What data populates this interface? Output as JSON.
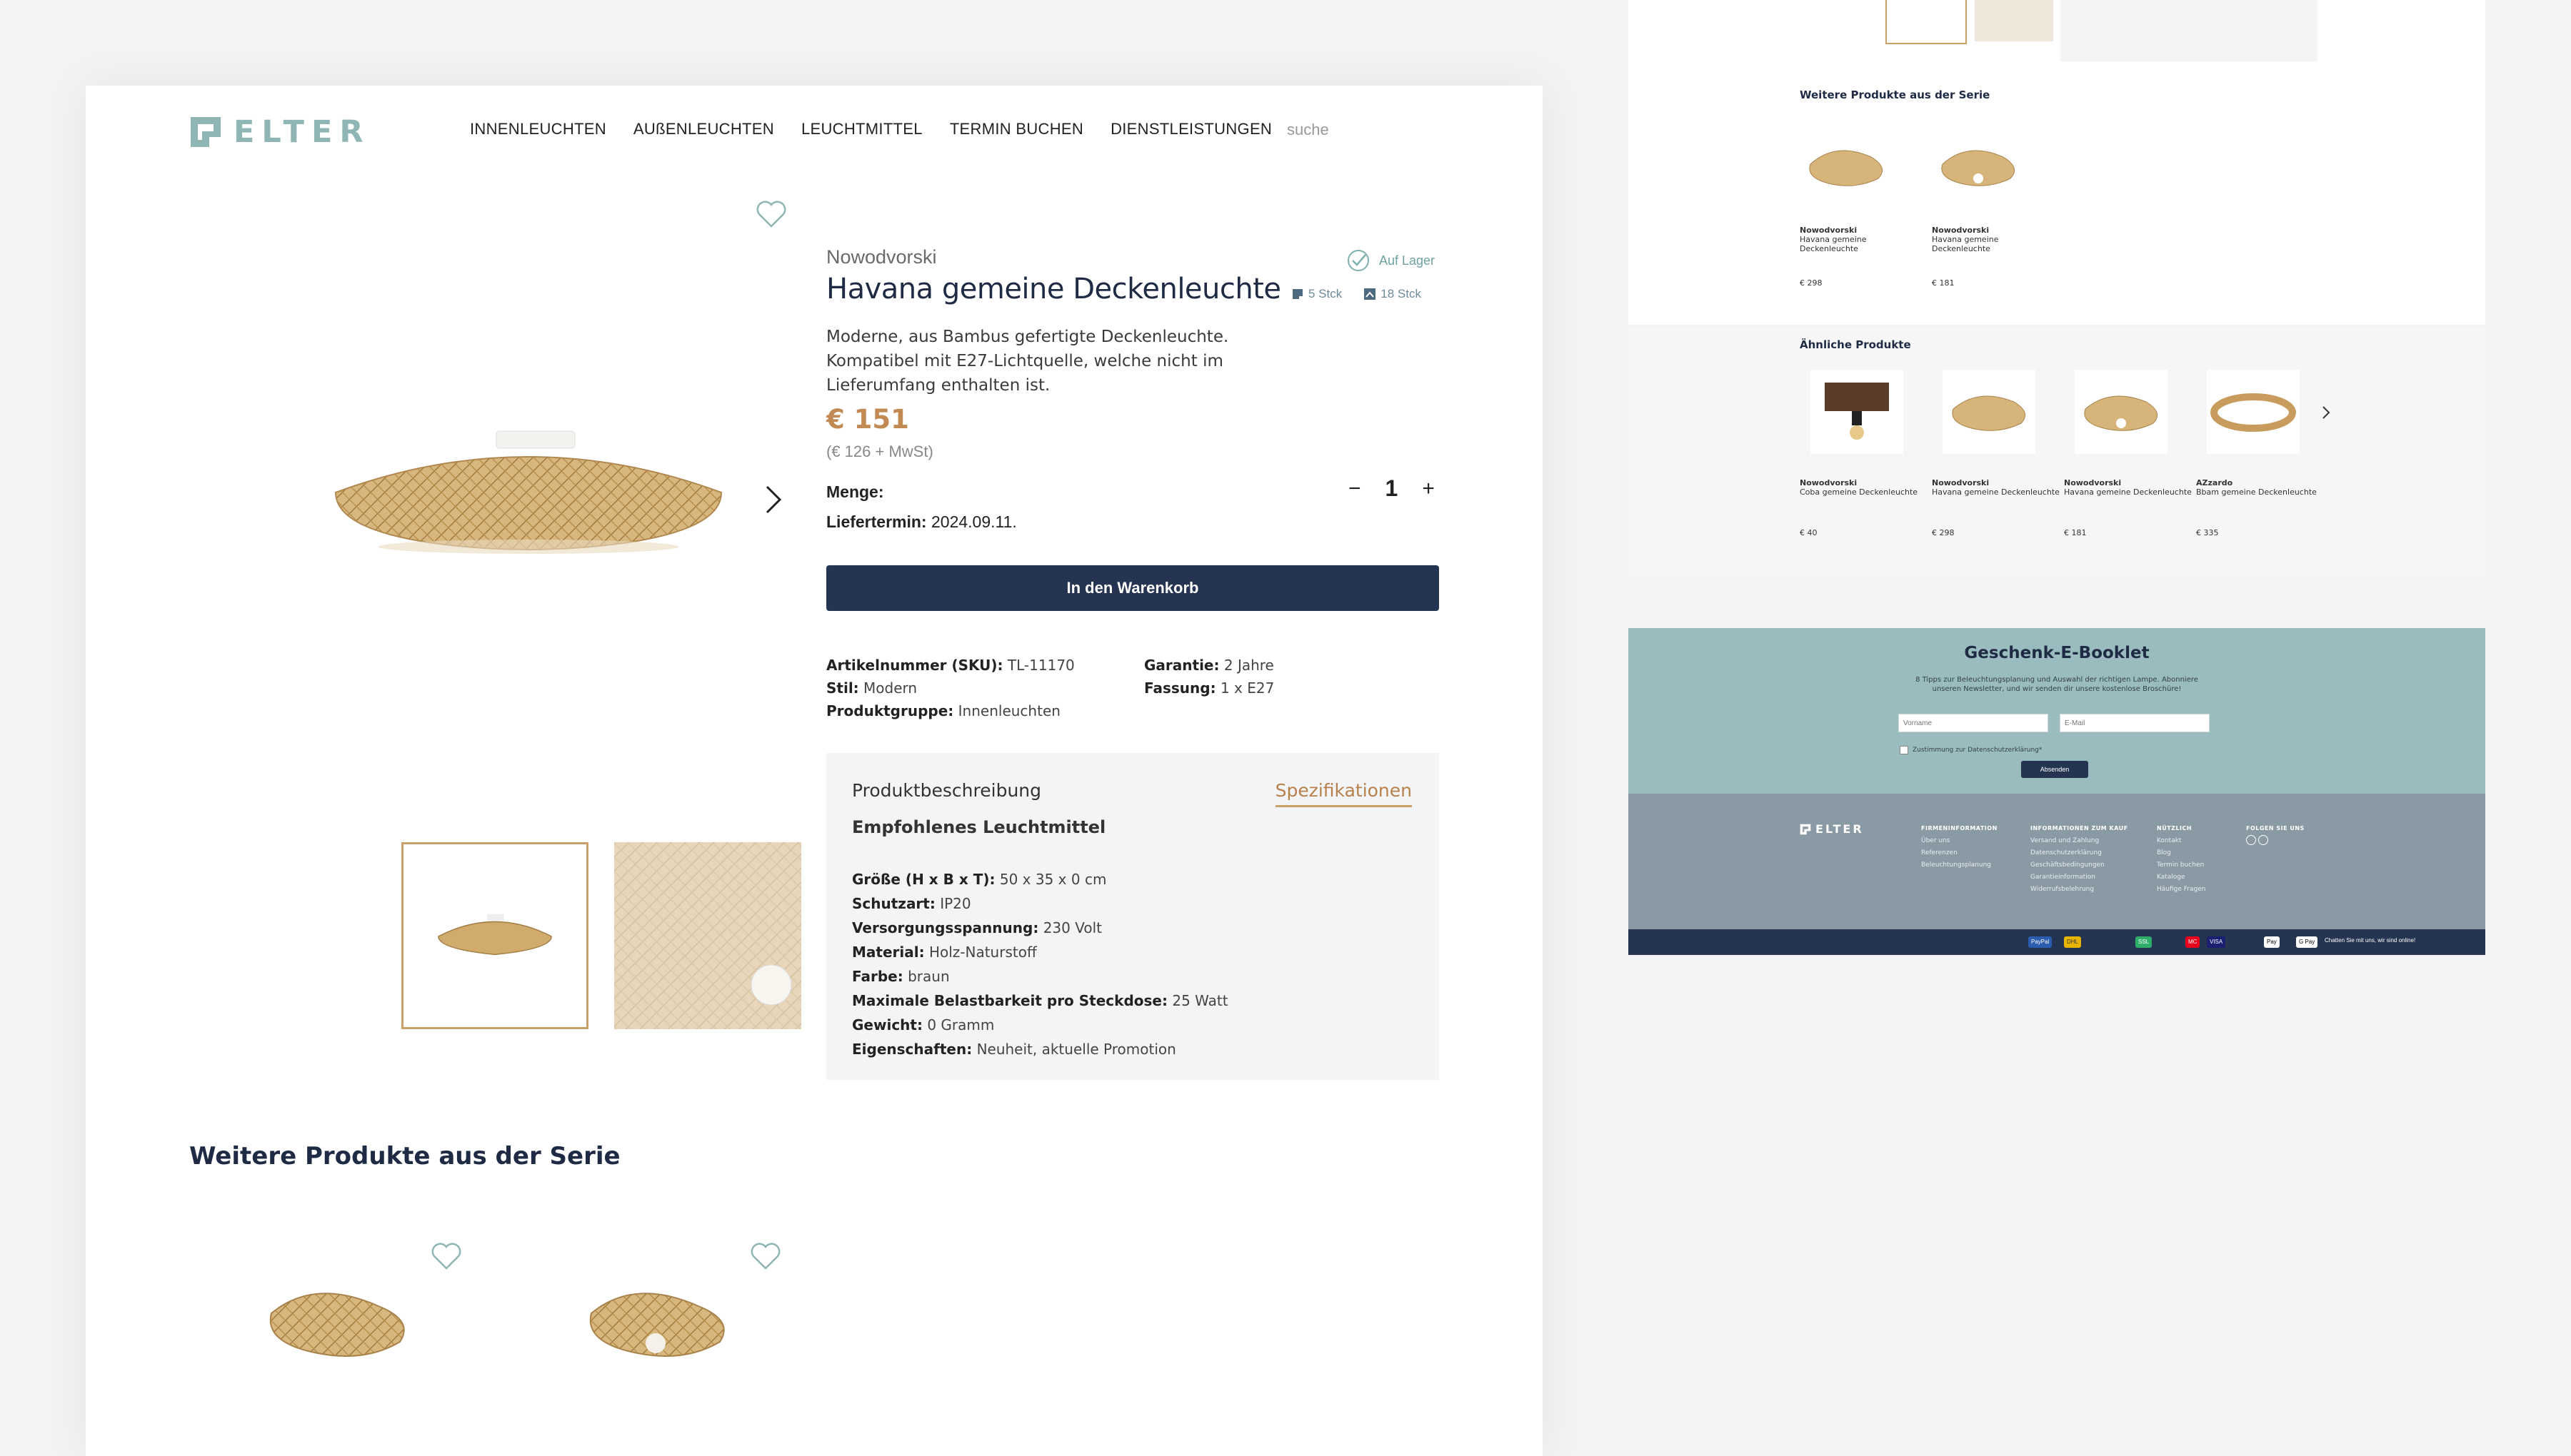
{
  "brand": {
    "name": "ELTER"
  },
  "nav": [
    "INNENLEUCHTEN",
    "AUßENLEUCHTEN",
    "LEUCHTMITTEL",
    "TERMIN BUCHEN",
    "DIENSTLEISTUNGEN"
  ],
  "search": {
    "placeholder": "suche"
  },
  "product": {
    "brand": "Nowodvorski",
    "title": "Havana gemeine Deckenleuchte",
    "stock_status": "Auf Lager",
    "stock_a": "5 Stck",
    "stock_b": "18 Stck",
    "description": "Moderne, aus Bambus gefertigte Deckenleuchte. Kompatibel mit E27-Lichtquelle, welche nicht im Lieferumfang enthalten ist.",
    "price": "€ 151",
    "price_net": "(€ 126 + MwSt)",
    "qty_label": "Menge:",
    "qty_value": "1",
    "delivery_label": "Liefertermin:",
    "delivery_value": "2024.09.11.",
    "cart_button": "In den Warenkorb"
  },
  "attributes": [
    {
      "label": "Artikelnummer (SKU):",
      "value": "TL-11170"
    },
    {
      "label": "Garantie:",
      "value": "2 Jahre"
    },
    {
      "label": "Stil:",
      "value": "Modern"
    },
    {
      "label": "Fassung:",
      "value": "1 x E27"
    },
    {
      "label": "Produktgruppe:",
      "value": "Innenleuchten"
    }
  ],
  "tabs": {
    "description": "Produktbeschreibung",
    "specs": "Spezifikationen"
  },
  "recommended": "Empfohlenes Leuchtmittel",
  "specs": [
    {
      "label": "Größe (H x B x T):",
      "value": "50 x 35 x 0 cm"
    },
    {
      "label": "Schutzart:",
      "value": "IP20"
    },
    {
      "label": "Versorgungsspannung:",
      "value": "230 Volt"
    },
    {
      "label": "Material:",
      "value": "Holz-Naturstoff"
    },
    {
      "label": "Farbe:",
      "value": "braun"
    },
    {
      "label": "Maximale Belastbarkeit pro Steckdose:",
      "value": "25 Watt"
    },
    {
      "label": "Gewicht:",
      "value": "0 Gramm"
    },
    {
      "label": "Eigenschaften:",
      "value": "Neuheit, aktuelle Promotion"
    }
  ],
  "series_title": "Weitere Produkte aus der Serie",
  "preview": {
    "series_title": "Weitere Produkte aus der Serie",
    "series_items": [
      {
        "brand": "Nowodvorski",
        "name": "Havana gemeine Deckenleuchte",
        "price": "€ 298"
      },
      {
        "brand": "Nowodvorski",
        "name": "Havana gemeine Deckenleuchte",
        "price": "€ 181"
      }
    ],
    "similar_title": "Ähnliche Produkte",
    "similar_items": [
      {
        "brand": "Nowodvorski",
        "name": "Coba gemeine Deckenleuchte",
        "price": "€ 40"
      },
      {
        "brand": "Nowodvorski",
        "name": "Havana gemeine Deckenleuchte",
        "price": "€ 298"
      },
      {
        "brand": "Nowodvorski",
        "name": "Havana gemeine Deckenleuchte",
        "price": "€ 181"
      },
      {
        "brand": "AZzardo",
        "name": "Bbam gemeine Deckenleuchte",
        "price": "€ 335"
      }
    ],
    "newsletter_title": "Geschenk-E-Booklet",
    "newsletter_text": "8 Tipps zur Beleuchtungsplanung und Auswahl der richtigen Lampe. Abonniere unseren Newsletter, und wir senden dir unsere kostenlose Broschüre!",
    "newsletter_name": "Vorname",
    "newsletter_email": "E-Mail",
    "newsletter_consent": "Zustimmung zur Datenschutzerklärung*",
    "newsletter_button": "Absenden",
    "footer_cols": [
      {
        "head": "FIRMENINFORMATION",
        "items": [
          "Über uns",
          "Referenzen",
          "Beleuchtungsplanung"
        ]
      },
      {
        "head": "INFORMATIONEN ZUM KAUF",
        "items": [
          "Versand und Zahlung",
          "Datenschutzerklärung",
          "Geschäftsbedingungen",
          "Garantieinformation",
          "Widerrufsbelehrung"
        ]
      },
      {
        "head": "NÜTZLICH",
        "items": [
          "Kontakt",
          "Blog",
          "Termin buchen",
          "Kataloge",
          "Häufige Fragen"
        ]
      },
      {
        "head": "FOLGEN SIE UNS",
        "items": []
      }
    ],
    "chat": "Chatten Sie mit uns, wir sind online!"
  }
}
